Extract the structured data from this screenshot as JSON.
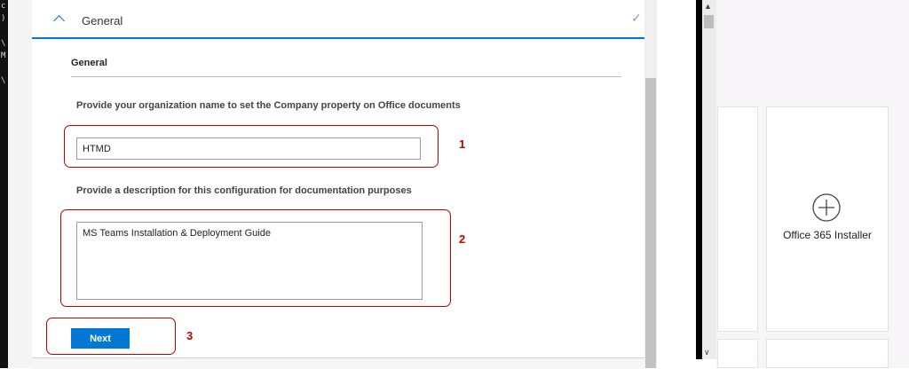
{
  "terminal": {
    "lines": [
      "c",
      ")",
      "",
      "\\",
      "M",
      "",
      "\\"
    ]
  },
  "panel": {
    "header_title": "General",
    "section_title": "General",
    "org_question": "Provide your organization name to set the Company property on Office documents",
    "org_value": "HTMD",
    "desc_question": "Provide a description for this configuration for documentation purposes",
    "desc_value": "MS Teams Installation & Deployment Guide",
    "next_label": "Next"
  },
  "annotations": {
    "one": "1",
    "two": "2",
    "three": "3"
  },
  "right": {
    "tile_label": "Office 365 Installer",
    "tile_icon": "plus-circle-icon"
  },
  "colors": {
    "accent": "#0078d4",
    "annotation": "#c00000"
  }
}
